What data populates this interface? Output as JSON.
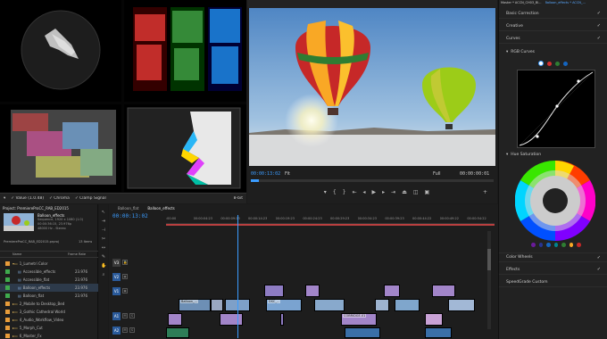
{
  "scopes": {
    "bar": {
      "zoom": "8-bit",
      "values": [
        "✓ Value (1.0.48)",
        "✓ Chroma",
        "✓ Clamp Signal"
      ],
      "bit_depth": "8-bit"
    }
  },
  "program": {
    "tab": "Program: ...",
    "timecode": "00:00:13:02",
    "fit": "Fit",
    "quality": "Full",
    "duration": "00:00:00:01"
  },
  "lumetri": {
    "header_left": "Master * ACCN_CH03_Bl...",
    "header_right": "Balloon_effects * ACCN_...",
    "sections": [
      {
        "label": "Basic Correction",
        "check": "✓"
      },
      {
        "label": "Creative",
        "check": "✓"
      },
      {
        "label": "Curves",
        "check": "✓"
      },
      {
        "label": "RGB Curves",
        "check": ""
      }
    ],
    "hue_label": "Hue Saturation",
    "bottom_sections": [
      {
        "label": "Color Wheels",
        "check": "✓"
      },
      {
        "label": "Effects",
        "check": "✓"
      },
      {
        "label": "SpeedGrade Custom",
        "check": ""
      }
    ],
    "colors": {
      "white": "#ffffff",
      "red": "#d32f2f",
      "green": "#2e7d32",
      "blue": "#1565c0"
    }
  },
  "project": {
    "title": "Project: PremiereProCC_RAB_ED2015",
    "thumb_title": "Balloon_effects",
    "thumb_info_1": "Sequence, 1920 x 1080 (1.0)",
    "thumb_info_2": "00:00:36:15, 23.976p",
    "thumb_info_3": "48000 Hz - Stereo",
    "file": "PremiereProCC_RAB_ED2015.prproj",
    "count": "13 Items",
    "col_name": "Name",
    "col_rate": "Frame Rate",
    "rows": [
      {
        "name": "1_Lumetri Color",
        "rate": "",
        "color": "#e89c3a",
        "indent": 0,
        "open": true
      },
      {
        "name": "Accessible_effects",
        "rate": "23.976",
        "color": "#3faa4d",
        "indent": 1
      },
      {
        "name": "Accessible_flat",
        "rate": "23.976",
        "color": "#3faa4d",
        "indent": 1
      },
      {
        "name": "Balloon_effects",
        "rate": "23.976",
        "color": "#3faa4d",
        "indent": 1
      },
      {
        "name": "Balloon_flat",
        "rate": "23.976",
        "color": "#3faa4d",
        "indent": 1
      },
      {
        "name": "2_Mobile to Desktop_Bed",
        "rate": "",
        "color": "#e89c3a",
        "indent": 0
      },
      {
        "name": "3_Gothic Cathedral World",
        "rate": "",
        "color": "#e89c3a",
        "indent": 0
      },
      {
        "name": "4_Audio_Workflow_Video",
        "rate": "",
        "color": "#e89c3a",
        "indent": 0
      },
      {
        "name": "5_Morph_Cut",
        "rate": "",
        "color": "#e89c3a",
        "indent": 0
      },
      {
        "name": "6_Master_Fx",
        "rate": "",
        "color": "#e89c3a",
        "indent": 0
      }
    ]
  },
  "timeline": {
    "tab_1": "Balloon_flat",
    "tab_2": "Balloon_effects",
    "timecode": "00:00:13:02",
    "ruler": [
      ":00:00",
      "00:00:04:23",
      "00:00:09:23",
      "00:00:14:23",
      "00:00:19:23",
      "00:00:24:23",
      "00:00:29:23",
      "00:00:34:23",
      "00:00:39:23",
      "00:00:44:22",
      "00:00:49:22",
      "00:00:54:22"
    ],
    "tracks": [
      "V3",
      "V2",
      "V1",
      "A1",
      "A2"
    ],
    "clips_v2": [
      "wingsuit_01",
      "DSC_0109",
      "Balloon"
    ],
    "clip_labels": [
      "Balloon_...",
      "DSC_...",
      "COBRIDGE-01"
    ]
  }
}
